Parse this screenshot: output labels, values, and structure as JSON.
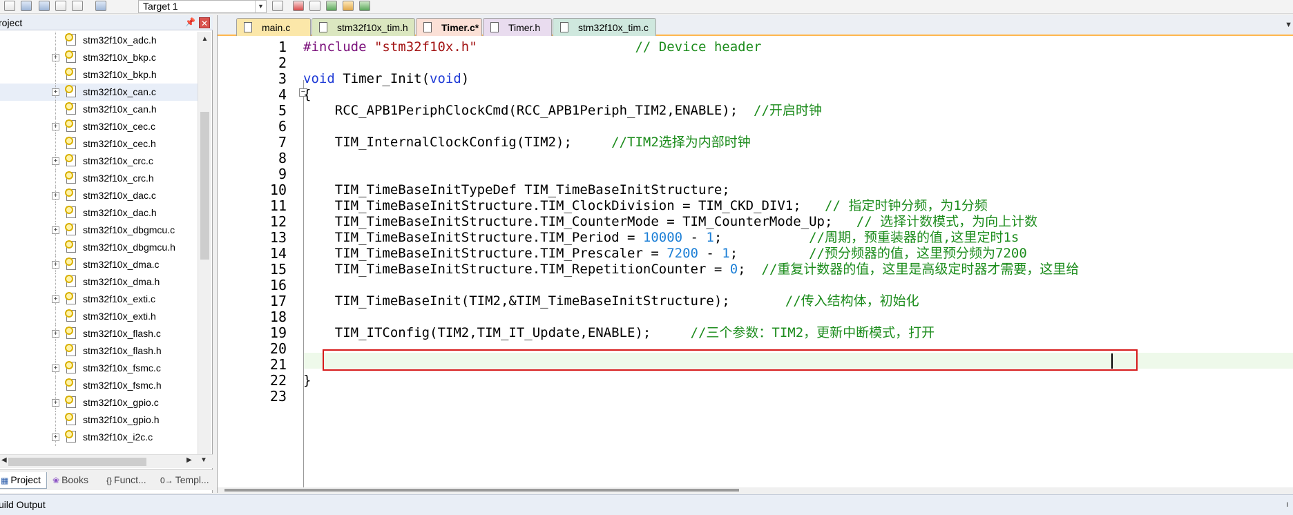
{
  "toolbar": {
    "target_value": "Target 1"
  },
  "project_panel": {
    "title": "roject",
    "tree_items": [
      {
        "label": "stm32f10x_adc.h",
        "expandable": false
      },
      {
        "label": "stm32f10x_bkp.c",
        "expandable": true
      },
      {
        "label": "stm32f10x_bkp.h",
        "expandable": false
      },
      {
        "label": "stm32f10x_can.c",
        "expandable": true,
        "selected": true
      },
      {
        "label": "stm32f10x_can.h",
        "expandable": false
      },
      {
        "label": "stm32f10x_cec.c",
        "expandable": true
      },
      {
        "label": "stm32f10x_cec.h",
        "expandable": false
      },
      {
        "label": "stm32f10x_crc.c",
        "expandable": true
      },
      {
        "label": "stm32f10x_crc.h",
        "expandable": false
      },
      {
        "label": "stm32f10x_dac.c",
        "expandable": true
      },
      {
        "label": "stm32f10x_dac.h",
        "expandable": false
      },
      {
        "label": "stm32f10x_dbgmcu.c",
        "expandable": true
      },
      {
        "label": "stm32f10x_dbgmcu.h",
        "expandable": false
      },
      {
        "label": "stm32f10x_dma.c",
        "expandable": true
      },
      {
        "label": "stm32f10x_dma.h",
        "expandable": false
      },
      {
        "label": "stm32f10x_exti.c",
        "expandable": true
      },
      {
        "label": "stm32f10x_exti.h",
        "expandable": false
      },
      {
        "label": "stm32f10x_flash.c",
        "expandable": true
      },
      {
        "label": "stm32f10x_flash.h",
        "expandable": false
      },
      {
        "label": "stm32f10x_fsmc.c",
        "expandable": true
      },
      {
        "label": "stm32f10x_fsmc.h",
        "expandable": false
      },
      {
        "label": "stm32f10x_gpio.c",
        "expandable": true
      },
      {
        "label": "stm32f10x_gpio.h",
        "expandable": false
      },
      {
        "label": "stm32f10x_i2c.c",
        "expandable": true
      }
    ],
    "bottom_tabs": [
      {
        "label": "Project",
        "icon": "project-icon",
        "active": true
      },
      {
        "label": "Books",
        "icon": "books-icon",
        "active": false
      },
      {
        "label": "Funct...",
        "icon": "functions-icon",
        "active": false
      },
      {
        "label": "Templ...",
        "icon": "templates-icon",
        "active": false
      }
    ]
  },
  "editor": {
    "tabs": [
      {
        "label": "main.c",
        "active": false
      },
      {
        "label": "stm32f10x_tim.h",
        "active": false
      },
      {
        "label": "Timer.c*",
        "active": true
      },
      {
        "label": "Timer.h",
        "active": false
      },
      {
        "label": "stm32f10x_tim.c",
        "active": false
      }
    ],
    "line_numbers": [
      "1",
      "2",
      "3",
      "4",
      "5",
      "6",
      "7",
      "8",
      "9",
      "10",
      "11",
      "12",
      "13",
      "14",
      "15",
      "16",
      "17",
      "18",
      "19",
      "20",
      "21",
      "22",
      "23"
    ],
    "code": {
      "l1_pp": "#include",
      "l1_str": "\"stm32f10x.h\"",
      "l1_cm": "// Device header",
      "l3_kw1": "void",
      "l3_fn": " Timer_Init(",
      "l3_kw2": "void",
      "l3_end": ")",
      "l4": "{",
      "l5": "RCC_APB1PeriphClockCmd(RCC_APB1Periph_TIM2,ENABLE);",
      "l5_cm": "//开启时钟",
      "l7": "TIM_InternalClockConfig(TIM2);",
      "l7_cm": "//TIM2选择为内部时钟",
      "l10": "TIM_TimeBaseInitTypeDef TIM_TimeBaseInitStructure;",
      "l11": "TIM_TimeBaseInitStructure.TIM_ClockDivision = TIM_CKD_DIV1;",
      "l11_cm": "// 指定时钟分频，为1分频",
      "l12": "TIM_TimeBaseInitStructure.TIM_CounterMode = TIM_CounterMode_Up;",
      "l12_cm": "// 选择计数模式，为向上计数",
      "l13": "TIM_TimeBaseInitStructure.TIM_Period = ",
      "l13_num1": "10000",
      "l13_op": " - ",
      "l13_num2": "1",
      "l13_end": ";",
      "l13_cm": "//周期，预重装器的值,这里定时1s",
      "l14": "TIM_TimeBaseInitStructure.TIM_Prescaler = ",
      "l14_num1": "7200",
      "l14_op": " - ",
      "l14_num2": "1",
      "l14_end": ";",
      "l14_cm": "//预分频器的值，这里预分频为7200",
      "l15": "TIM_TimeBaseInitStructure.TIM_RepetitionCounter = ",
      "l15_num": "0",
      "l15_end": ";",
      "l15_cm": "//重复计数器的值，这里是高级定时器才需要，这里给",
      "l17": "TIM_TimeBaseInit(TIM2,&TIM_TimeBaseInitStructure);",
      "l17_cm": "//传入结构体，初始化",
      "l19": "TIM_ITConfig(TIM2,TIM_IT_Update,ENABLE);",
      "l19_cm": "//三个参数：TIM2，更新中断模式，打开",
      "l22": "}"
    }
  },
  "build_output": {
    "title": "uild Output"
  }
}
